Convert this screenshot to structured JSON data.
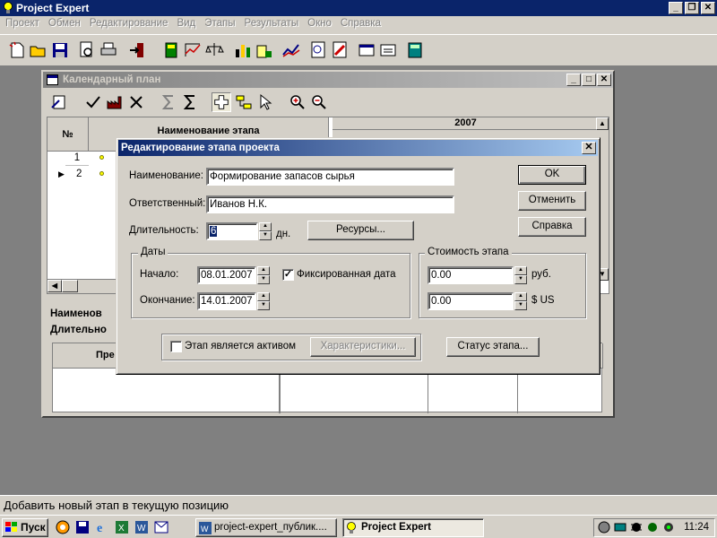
{
  "app": {
    "title": "Project Expert"
  },
  "menu": [
    "Проект",
    "Обмен",
    "Редактирование",
    "Вид",
    "Этапы",
    "Результаты",
    "Окно",
    "Справка"
  ],
  "toolbar_icons": [
    "new-icon",
    "open-icon",
    "save-icon",
    "preview-icon",
    "print-icon",
    "exit-icon",
    "calendar-icon",
    "cashflow-icon",
    "scales-icon",
    "chart-bar-icon",
    "chart-export-icon",
    "line-chart-icon",
    "report-icon",
    "report-edit-icon",
    "window-icon",
    "window2-icon",
    "calculator-icon"
  ],
  "calendar": {
    "title": "Календарный план",
    "col_no": "№",
    "col_name": "Наименование этапа",
    "year": "2007",
    "rows": [
      {
        "no": "1"
      },
      {
        "no": "2"
      }
    ],
    "lower_name_label": "Наименов",
    "lower_duration_label": "Длительно",
    "lower_col": "Пре"
  },
  "dialog": {
    "title": "Редактирование этапа проекта",
    "name_label": "Наименование:",
    "name_value": "Формирование запасов сырья",
    "resp_label": "Ответственный:",
    "resp_value": "Иванов Н.К.",
    "duration_label": "Длительность:",
    "duration_value": "6",
    "duration_unit": "дн.",
    "resources_button": "Ресурсы...",
    "dates_group": "Даты",
    "start_label": "Начало:",
    "start_value": "08.01.2007",
    "fixed_date_label": "Фиксированная дата",
    "fixed_date_checked": true,
    "end_label": "Окончание:",
    "end_value": "14.01.2007",
    "cost_group": "Стоимость этапа",
    "cost_rub_value": "0.00",
    "cost_rub_unit": "руб.",
    "cost_usd_value": "0.00",
    "cost_usd_unit": "$ US",
    "asset_label": "Этап является активом",
    "asset_checked": false,
    "characteristics_button": "Характеристики...",
    "status_button": "Статус этапа...",
    "ok_button": "OK",
    "cancel_button": "Отменить",
    "help_button": "Справка"
  },
  "statusbar": {
    "text": "Добавить новый этап в текущую позицию"
  },
  "taskbar": {
    "start": "Пуск",
    "tasks": [
      "project-expert_публик....",
      "Project Expert"
    ],
    "clock": "11:24"
  }
}
